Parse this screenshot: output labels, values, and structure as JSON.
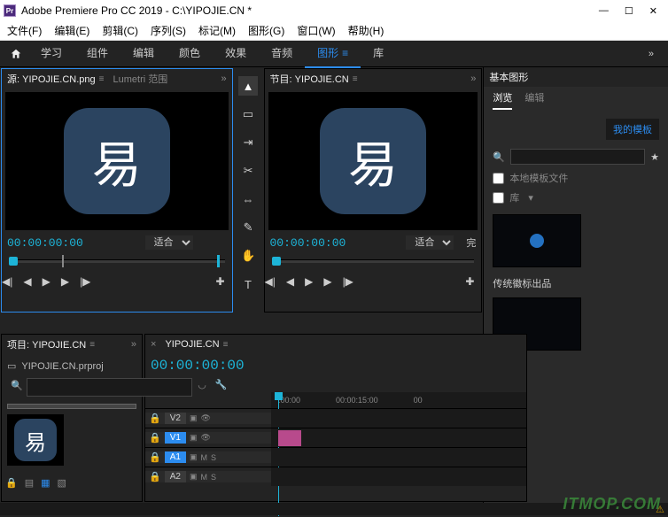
{
  "app": {
    "title": "Adobe Premiere Pro CC 2019 - C:\\YIPOJIE.CN *",
    "icon_label": "Pr"
  },
  "menubar": [
    "文件(F)",
    "编辑(E)",
    "剪辑(C)",
    "序列(S)",
    "标记(M)",
    "图形(G)",
    "窗口(W)",
    "帮助(H)"
  ],
  "tabs": {
    "items": [
      "学习",
      "组件",
      "编辑",
      "颜色",
      "效果",
      "音频",
      "图形",
      "库"
    ],
    "active_index": 6
  },
  "source_panel": {
    "title": "源: YIPOJIE.CN.png",
    "secondary_tab": "Lumetri 范围",
    "timecode": "00:00:00:00",
    "zoom": "适合",
    "glyph": "易"
  },
  "program_panel": {
    "title": "节目: YIPOJIE.CN",
    "timecode": "00:00:00:00",
    "zoom": "适合",
    "zoom2": "完",
    "glyph": "易"
  },
  "graphics_panel": {
    "title": "基本图形",
    "tabs": [
      "浏览",
      "编辑"
    ],
    "active": 0,
    "template_btn": "我的模板",
    "search_placeholder": "",
    "cb_local": "本地模板文件",
    "cb_lib": "库",
    "thumb_label": "传统徽标出品"
  },
  "project_panel": {
    "title": "项目: YIPOJIE.CN",
    "filename": "YIPOJIE.CN.prproj",
    "glyph": "易"
  },
  "timeline": {
    "title": "YIPOJIE.CN",
    "timecode": "00:00:00:00",
    "ruler": [
      ":00:00",
      "00:00:15:00",
      "00"
    ],
    "tracks": [
      {
        "name": "V2",
        "type": "video",
        "selected": false
      },
      {
        "name": "V1",
        "type": "video",
        "selected": true,
        "has_clip": true
      },
      {
        "name": "A1",
        "type": "audio",
        "selected": true
      },
      {
        "name": "A2",
        "type": "audio",
        "selected": false
      }
    ]
  },
  "watermark": "ITMOP.COM"
}
